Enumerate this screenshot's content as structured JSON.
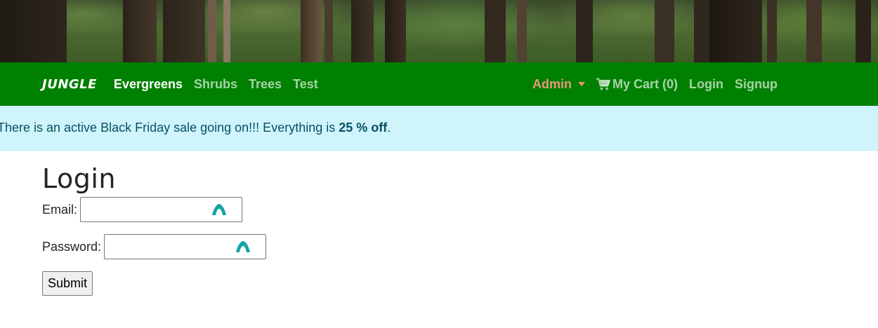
{
  "nav": {
    "brand": "JUNGLE",
    "links": [
      "Evergreens",
      "Shrubs",
      "Trees",
      "Test"
    ],
    "admin_label": "Admin",
    "cart_label": "My Cart (0)",
    "login_label": "Login",
    "signup_label": "Signup"
  },
  "alert": {
    "text": "There is an active Black Friday sale going on!!! Everything is ",
    "discount": "25 % off",
    "suffix": "."
  },
  "page": {
    "title": "Login",
    "email_label": "Email:",
    "email_value": "",
    "password_label": "Password:",
    "password_value": "",
    "submit_label": "Submit"
  },
  "colors": {
    "navbar": "#008000",
    "admin": "#e9967a",
    "alert_bg": "#cff4fc",
    "alert_text": "#055160",
    "input_icon": "#17a2a2"
  },
  "icons": [
    "cart-icon",
    "password-manager-icon",
    "caret-down-icon"
  ]
}
